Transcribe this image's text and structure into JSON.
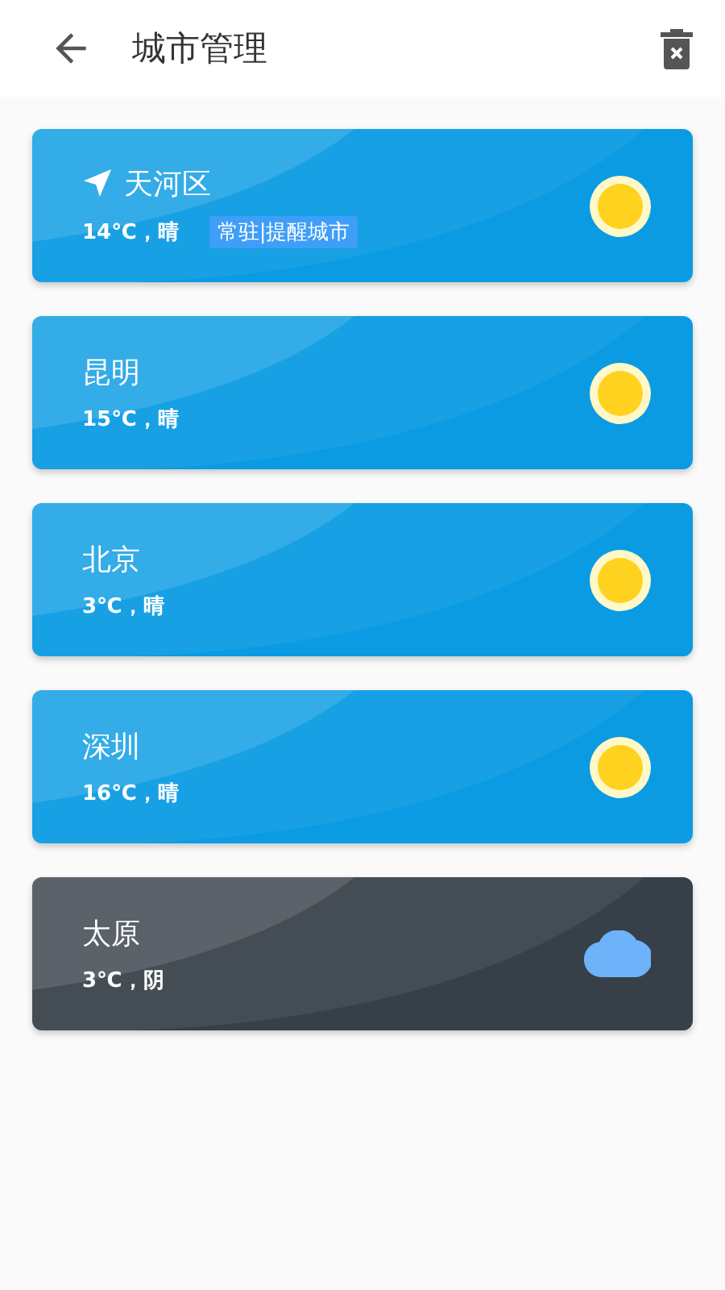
{
  "header": {
    "title": "城市管理"
  },
  "cities": [
    {
      "name": "天河区",
      "weather": "14℃，晴",
      "located": true,
      "tag": "常驻|提醒城市",
      "kind": "sunny"
    },
    {
      "name": "昆明",
      "weather": "15℃，晴",
      "located": false,
      "kind": "sunny"
    },
    {
      "name": "北京",
      "weather": "3℃，晴",
      "located": false,
      "kind": "sunny"
    },
    {
      "name": "深圳",
      "weather": "16℃，晴",
      "located": false,
      "kind": "sunny"
    },
    {
      "name": "太原",
      "weather": "3℃，阴",
      "located": false,
      "kind": "cloudy"
    }
  ]
}
